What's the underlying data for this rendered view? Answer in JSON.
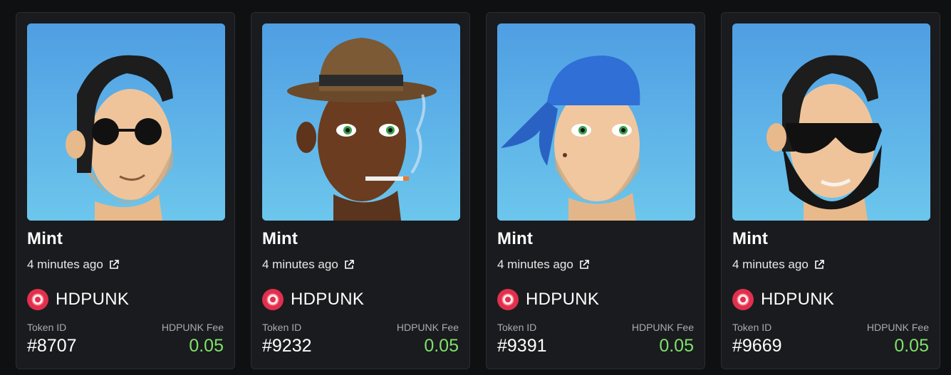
{
  "cards": [
    {
      "event": "Mint",
      "time": "4 minutes ago",
      "collection": "HDPUNK",
      "token_label": "Token ID",
      "token_id": "#8707",
      "fee_label": "HDPUNK Fee",
      "fee": "0.05",
      "art": "punk-slick-hair-round-sunglasses"
    },
    {
      "event": "Mint",
      "time": "4 minutes ago",
      "collection": "HDPUNK",
      "token_label": "Token ID",
      "token_id": "#9232",
      "fee_label": "HDPUNK Fee",
      "fee": "0.05",
      "art": "punk-fedora-cigarette"
    },
    {
      "event": "Mint",
      "time": "4 minutes ago",
      "collection": "HDPUNK",
      "token_label": "Token ID",
      "token_id": "#9391",
      "fee_label": "HDPUNK Fee",
      "fee": "0.05",
      "art": "punk-blue-bandana"
    },
    {
      "event": "Mint",
      "time": "4 minutes ago",
      "collection": "HDPUNK",
      "token_label": "Token ID",
      "token_id": "#9669",
      "fee_label": "HDPUNK Fee",
      "fee": "0.05",
      "art": "punk-full-beard-sunglasses"
    }
  ],
  "colors": {
    "background": "#0f1012",
    "card": "#1a1b1e",
    "fee": "#7ee06a",
    "sky": "#5aa9e6"
  }
}
